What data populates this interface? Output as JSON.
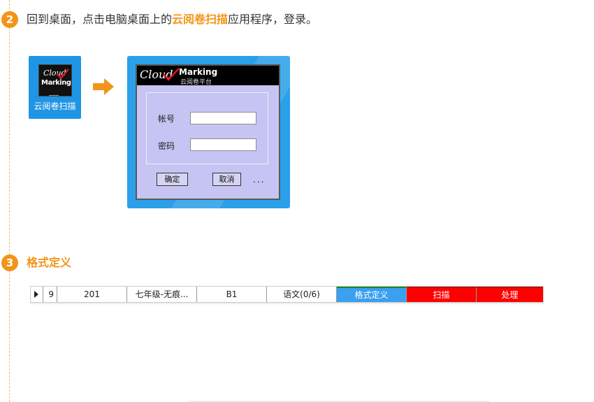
{
  "step2": {
    "number": "2",
    "text_before": "回到桌面，点击电脑桌面上的",
    "highlight": "云阅卷扫描",
    "text_after": "应用程序，登录。"
  },
  "desktop_icon": {
    "logo_cloud": "Cloud",
    "logo_marking": "Marking",
    "label": "云阅卷扫描"
  },
  "login_dialog": {
    "brand_cloud": "Cloud",
    "brand_marking": "Marking",
    "brand_subtitle": "云阅卷平台",
    "account_label": "帐号",
    "password_label": "密码",
    "account_value": "",
    "password_value": "",
    "ok_label": "确定",
    "cancel_label": "取消",
    "more_label": "..."
  },
  "step3": {
    "number": "3",
    "title": "格式定义"
  },
  "task_row": {
    "index": "9",
    "cells": [
      "201",
      "七年级-无痕...",
      "B1",
      "语文(0/6)"
    ],
    "format_button": "格式定义",
    "scan_button": "扫描",
    "process_button": "处理"
  },
  "colors": {
    "accent": "#f39418",
    "desktop_blue": "#1f95e4",
    "dialog_purple": "#c5c4f2",
    "button_blue": "#3aa0ef",
    "button_red": "#ff0000"
  }
}
